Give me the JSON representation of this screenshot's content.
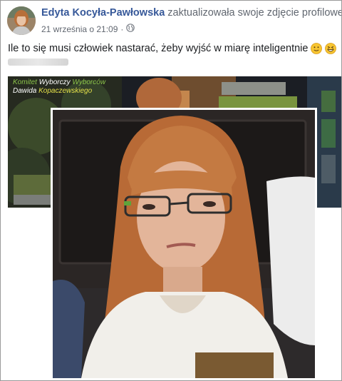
{
  "post": {
    "author": "Edyta Kocyła-Pawłowska",
    "action": "zaktualizowała swoje zdjęcie profilowe.",
    "timestamp": "21 września o 21:09",
    "separator": "·",
    "audience_icon": "globe-icon",
    "text": "Ile to się musi człowiek nastarać, żeby wyjść w miarę inteligentnie",
    "emojis": [
      "slightly-smiling-face-emoji",
      "grinning-squinting-face-emoji"
    ]
  },
  "cover": {
    "caption_line1_part1": "Komitet",
    "caption_line1_part2": "Wyborczy",
    "caption_line1_part3": "Wyborców",
    "caption_line2_part1": "Dawida",
    "caption_line2_part2": "Kopaczewskiego"
  },
  "colors": {
    "author_link": "#365899",
    "meta_text": "#616770",
    "caption_green": "#8bc34a",
    "caption_yellow": "#e4e14a"
  }
}
